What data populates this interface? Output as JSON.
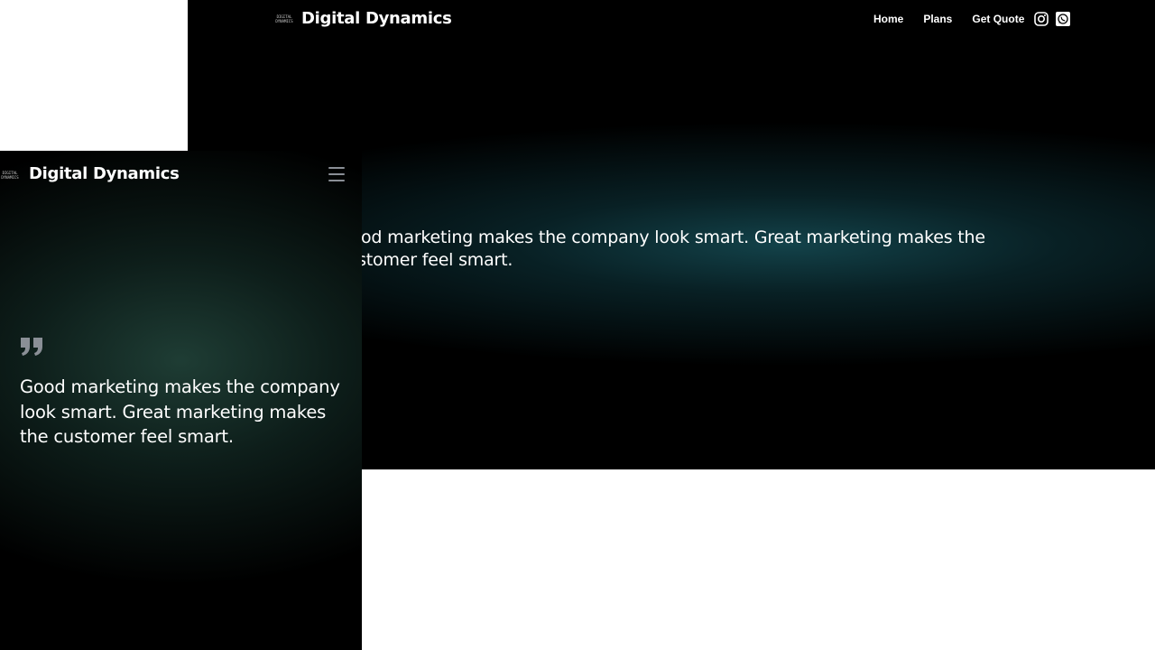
{
  "desktop": {
    "brand": {
      "logo_text": "DIGITAL DYNAMICS",
      "name": "Digital Dynamics"
    },
    "nav": [
      {
        "label": "Home"
      },
      {
        "label": "Plans"
      },
      {
        "label": "Get Quote"
      }
    ],
    "social": [
      {
        "icon": "instagram-icon"
      },
      {
        "icon": "whatsapp-icon"
      }
    ],
    "quote": "Good marketing makes the company look smart. Great marketing makes the customer feel smart."
  },
  "mobile": {
    "brand": {
      "logo_text": "DIGITAL DYNAMICS",
      "name": "Digital Dynamics"
    },
    "menu_icon": "hamburger-menu-icon",
    "quote_icon": "quote-icon",
    "quote": "Good marketing makes the company look smart. Great marketing makes the customer feel smart."
  },
  "colors": {
    "background": "#000000",
    "accent_glow_desktop": "#14464e",
    "accent_glow_mobile": "#204037",
    "text": "#ffffff",
    "icon_muted": "#8a8f96"
  }
}
